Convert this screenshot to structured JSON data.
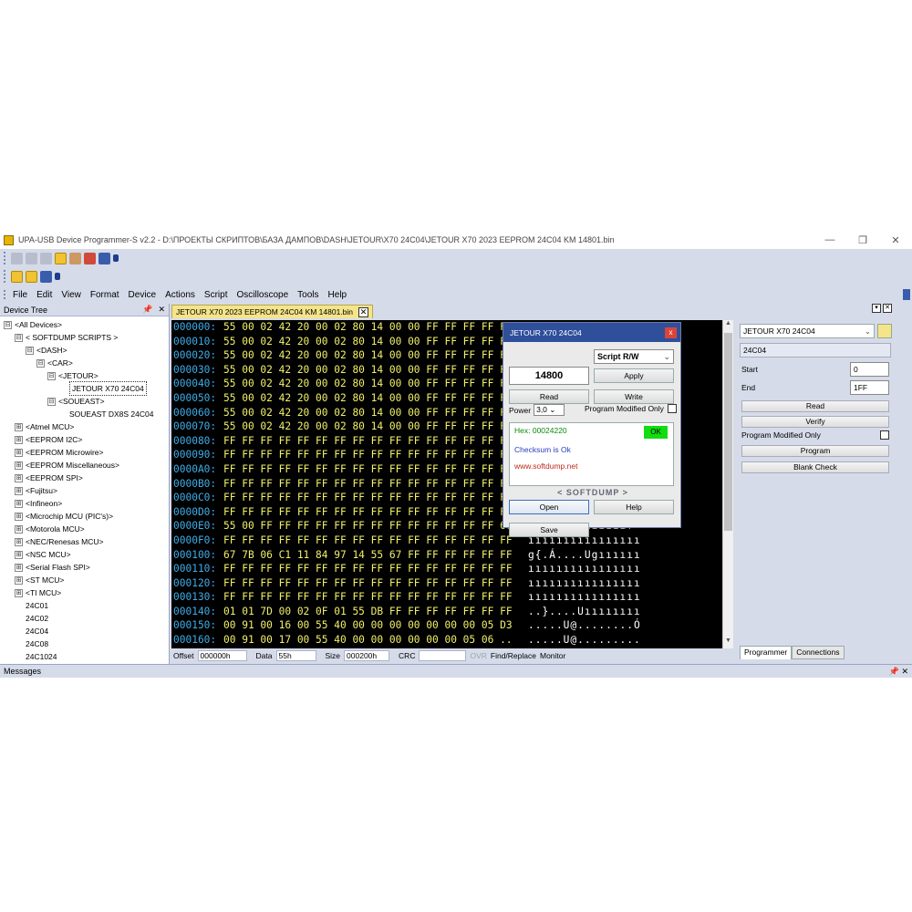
{
  "window": {
    "title": "UPA-USB Device Programmer-S v2.2 - D:\\ПРОЕКТЫ СКРИПТОВ\\БАЗА ДАМПОВ\\DASH\\JETOUR\\X70 24C04\\JETOUR X70 2023 EEPROM 24C04 KM 14801.bin",
    "minimize": "—",
    "maximize": "❐",
    "close": "✕"
  },
  "menu": [
    "File",
    "Edit",
    "View",
    "Format",
    "Device",
    "Actions",
    "Script",
    "Oscilloscope",
    "Tools",
    "Help"
  ],
  "device_tree": {
    "title": "Device Tree",
    "pin": "📌",
    "close": "✕",
    "items": [
      {
        "label": "<All Devices>",
        "toggle": "⊟",
        "indent": 0
      },
      {
        "label": "< SOFTDUMP SCRIPTS >",
        "toggle": "⊟",
        "indent": 1
      },
      {
        "label": "<DASH>",
        "toggle": "⊟",
        "indent": 2
      },
      {
        "label": "<CAR>",
        "toggle": "⊟",
        "indent": 3
      },
      {
        "label": "<JETOUR>",
        "toggle": "⊟",
        "indent": 4
      },
      {
        "label": "JETOUR X70 24C04",
        "toggle": "",
        "indent": 5,
        "selected": true
      },
      {
        "label": "<SOUEAST>",
        "toggle": "⊟",
        "indent": 4
      },
      {
        "label": "SOUEAST DX8S 24C04",
        "toggle": "",
        "indent": 5
      },
      {
        "label": "<Atmel MCU>",
        "toggle": "⊞",
        "indent": 1
      },
      {
        "label": "<EEPROM I2C>",
        "toggle": "⊞",
        "indent": 1
      },
      {
        "label": "<EEPROM Microwire>",
        "toggle": "⊞",
        "indent": 1
      },
      {
        "label": "<EEPROM Miscellaneous>",
        "toggle": "⊞",
        "indent": 1
      },
      {
        "label": "<EEPROM SPI>",
        "toggle": "⊞",
        "indent": 1
      },
      {
        "label": "<Fujitsu>",
        "toggle": "⊞",
        "indent": 1
      },
      {
        "label": "<Infineon>",
        "toggle": "⊞",
        "indent": 1
      },
      {
        "label": "<Microchip MCU (PIC's)>",
        "toggle": "⊞",
        "indent": 1
      },
      {
        "label": "<Motorola MCU>",
        "toggle": "⊞",
        "indent": 1
      },
      {
        "label": "<NEC/Renesas MCU>",
        "toggle": "⊞",
        "indent": 1
      },
      {
        "label": "<NSC MCU>",
        "toggle": "⊞",
        "indent": 1
      },
      {
        "label": "<Serial Flash SPI>",
        "toggle": "⊞",
        "indent": 1
      },
      {
        "label": "<ST MCU>",
        "toggle": "⊞",
        "indent": 1
      },
      {
        "label": "<TI MCU>",
        "toggle": "⊞",
        "indent": 1
      },
      {
        "label": "24C01",
        "toggle": "",
        "indent": 1
      },
      {
        "label": "24C02",
        "toggle": "",
        "indent": 1
      },
      {
        "label": "24C04",
        "toggle": "",
        "indent": 1
      },
      {
        "label": "24C08",
        "toggle": "",
        "indent": 1
      },
      {
        "label": "24C1024",
        "toggle": "",
        "indent": 1
      }
    ]
  },
  "document_tab": {
    "label": "JETOUR X70 2023 EEPROM 24C04 KM 14801.bin",
    "close": "✕"
  },
  "hex_rows": [
    {
      "addr": "000000:",
      "bytes": "55 00 02 42 20 00 02 80 14 00 00 FF FF FF FF FF",
      "ascii": ""
    },
    {
      "addr": "000010:",
      "bytes": "55 00 02 42 20 00 02 80 14 00 00 FF FF FF FF FF",
      "ascii": ""
    },
    {
      "addr": "000020:",
      "bytes": "55 00 02 42 20 00 02 80 14 00 00 FF FF FF FF FF",
      "ascii": ""
    },
    {
      "addr": "000030:",
      "bytes": "55 00 02 42 20 00 02 80 14 00 00 FF FF FF FF FF",
      "ascii": ""
    },
    {
      "addr": "000040:",
      "bytes": "55 00 02 42 20 00 02 80 14 00 00 FF FF FF FF FF",
      "ascii": ""
    },
    {
      "addr": "000050:",
      "bytes": "55 00 02 42 20 00 02 80 14 00 00 FF FF FF FF FF",
      "ascii": ""
    },
    {
      "addr": "000060:",
      "bytes": "55 00 02 42 20 00 02 80 14 00 00 FF FF FF FF FF",
      "ascii": ""
    },
    {
      "addr": "000070:",
      "bytes": "55 00 02 42 20 00 02 80 14 00 00 FF FF FF FF FF",
      "ascii": ""
    },
    {
      "addr": "000080:",
      "bytes": "FF FF FF FF FF FF FF FF FF FF FF FF FF FF FF FF",
      "ascii": ""
    },
    {
      "addr": "000090:",
      "bytes": "FF FF FF FF FF FF FF FF FF FF FF FF FF FF FF FF",
      "ascii": ""
    },
    {
      "addr": "0000A0:",
      "bytes": "FF FF FF FF FF FF FF FF FF FF FF FF FF FF FF FF",
      "ascii": ""
    },
    {
      "addr": "0000B0:",
      "bytes": "FF FF FF FF FF FF FF FF FF FF FF FF FF FF FF FF",
      "ascii": ""
    },
    {
      "addr": "0000C0:",
      "bytes": "FF FF FF FF FF FF FF FF FF FF FF FF FF FF FF FF",
      "ascii": ""
    },
    {
      "addr": "0000D0:",
      "bytes": "FF FF FF FF FF FF FF FF FF FF FF FF FF FF FF FF",
      "ascii": ""
    },
    {
      "addr": "0000E0:",
      "bytes": "55 00 FF FF FF FF FF FF FF FF FF FF FF FF FF 66",
      "ascii": "U.ııııııııııııf"
    },
    {
      "addr": "0000F0:",
      "bytes": "FF FF FF FF FF FF FF FF FF FF FF FF FF FF FF FF",
      "ascii": "ıııııııııııııııı"
    },
    {
      "addr": "000100:",
      "bytes": "67 7B 06 C1 11 84 97 14 55 67 FF FF FF FF FF FF",
      "ascii": "g{.Á....Ugıııııı"
    },
    {
      "addr": "000110:",
      "bytes": "FF FF FF FF FF FF FF FF FF FF FF FF FF FF FF FF",
      "ascii": "ıııııııııııııııı"
    },
    {
      "addr": "000120:",
      "bytes": "FF FF FF FF FF FF FF FF FF FF FF FF FF FF FF FF",
      "ascii": "ıııııııııııııııı"
    },
    {
      "addr": "000130:",
      "bytes": "FF FF FF FF FF FF FF FF FF FF FF FF FF FF FF FF",
      "ascii": "ıııııııııııııııı"
    },
    {
      "addr": "000140:",
      "bytes": "01 01 7D 00 02 0F 01 55 DB FF FF FF FF FF FF FF",
      "ascii": "..}....Uıııııııı"
    },
    {
      "addr": "000150:",
      "bytes": "00 91 00 16 00 55 40 00 00 00 00 00 00 00 05 D3",
      "ascii": ".....U@........Ó"
    },
    {
      "addr": "000160:",
      "bytes": "00 91 00 17 00 55 40 00 00 00 00 00 00 05 06 ..",
      "ascii": ".....U@........."
    }
  ],
  "statusbar": {
    "offset_label": "Offset",
    "offset_value": "000000h",
    "data_label": "Data",
    "data_value": "55h",
    "size_label": "Size",
    "size_value": "000200h",
    "crc_label": "CRC",
    "crc_value": "",
    "ovr": "OVR",
    "find_replace": "Find/Replace",
    "monitor": "Monitor"
  },
  "dialog": {
    "title": "JETOUR X70 24C04",
    "close": "x",
    "mode": "Script R/W",
    "value": "14800",
    "apply": "Apply",
    "read": "Read",
    "write": "Write",
    "power_label": "Power",
    "power_value": "3,0",
    "program_modified_only": "Program Modified Only",
    "hex_line": "Hex: 00024220",
    "ok": "OK",
    "checksum": "Checksum is Ok",
    "website": "www.softdump.net",
    "brand": "< SOFTDUMP >",
    "open": "Open",
    "help": "Help",
    "save": "Save",
    "chevron": "⌄"
  },
  "programmer": {
    "device_combo": "JETOUR X70 24C04",
    "chevron": "⌄",
    "chip": "24C04",
    "start_label": "Start",
    "start_value": "0",
    "end_label": "End",
    "end_value": "1FF",
    "read": "Read",
    "verify": "Verify",
    "program_modified_only": "Program Modified Only",
    "program": "Program",
    "blank_check": "Blank Check",
    "tabs": [
      "Programmer",
      "Connections"
    ],
    "pin_icon": "▾",
    "close_icon": "✕"
  },
  "messages": {
    "title": "Messages",
    "pin": "📌",
    "close": "✕"
  },
  "colors": {
    "hex_address": "#3eaeea",
    "hex_bytes": "#f2f06a",
    "dialog_title": "#2f4f9b",
    "ok_badge": "#11dd11"
  }
}
